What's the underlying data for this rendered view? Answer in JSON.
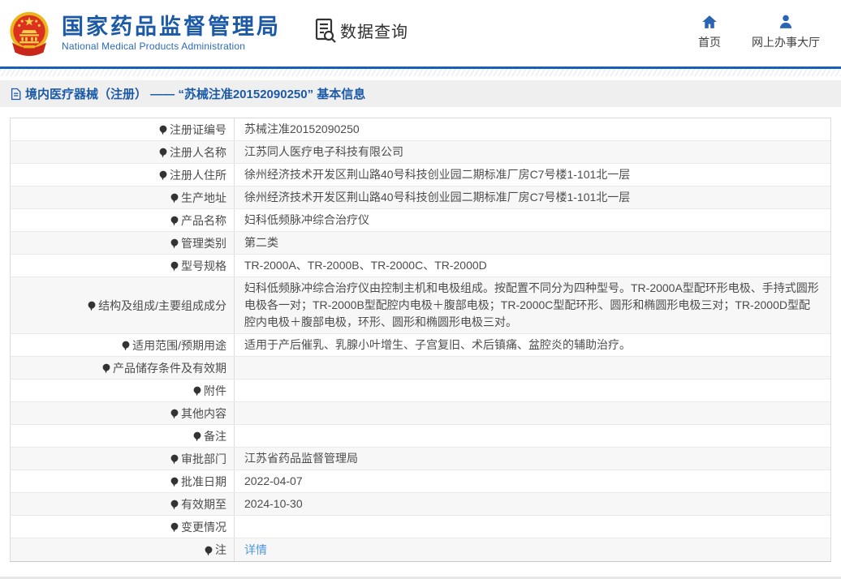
{
  "header": {
    "logo_title": "国家药品监督管理局",
    "logo_subtitle": "National Medical Products Administration",
    "section_label": "数据查询",
    "nav": [
      {
        "label": "首页",
        "icon": "home-icon"
      },
      {
        "label": "网上办事大厅",
        "icon": "user-icon"
      }
    ]
  },
  "breadcrumb": {
    "text": "境内医疗器械（注册） —— “苏械注准20152090250” 基本信息"
  },
  "table": {
    "rows": [
      {
        "label": "注册证编号",
        "value": "苏械注准20152090250"
      },
      {
        "label": "注册人名称",
        "value": "江苏同人医疗电子科技有限公司"
      },
      {
        "label": "注册人住所",
        "value": "徐州经济技术开发区荆山路40号科技创业园二期标准厂房C7号楼1-101北一层"
      },
      {
        "label": "生产地址",
        "value": "徐州经济技术开发区荆山路40号科技创业园二期标准厂房C7号楼1-101北一层"
      },
      {
        "label": "产品名称",
        "value": "妇科低频脉冲综合治疗仪"
      },
      {
        "label": "管理类别",
        "value": "第二类"
      },
      {
        "label": "型号规格",
        "value": "TR-2000A、TR-2000B、TR-2000C、TR-2000D"
      },
      {
        "label": "结构及组成/主要组成成分",
        "value": "妇科低频脉冲综合治疗仪由控制主机和电极组成。按配置不同分为四种型号。TR-2000A型配环形电极、手持式圆形电极各一对；TR-2000B型配腔内电极＋腹部电极；TR-2000C型配环形、圆形和椭圆形电极三对；TR-2000D型配腔内电极＋腹部电极，环形、圆形和椭圆形电极三对。"
      },
      {
        "label": "适用范围/预期用途",
        "value": "适用于产后催乳、乳腺小叶增生、子宫复旧、术后镇痛、盆腔炎的辅助治疗。"
      },
      {
        "label": "产品储存条件及有效期",
        "value": ""
      },
      {
        "label": "附件",
        "value": ""
      },
      {
        "label": "其他内容",
        "value": ""
      },
      {
        "label": "备注",
        "value": ""
      },
      {
        "label": "审批部门",
        "value": "江苏省药品监督管理局"
      },
      {
        "label": "批准日期",
        "value": "2022-04-07"
      },
      {
        "label": "有效期至",
        "value": "2024-10-30"
      },
      {
        "label": "变更情况",
        "value": ""
      },
      {
        "label": "注",
        "value": "详情",
        "link": true,
        "icon": "note-icon"
      }
    ]
  },
  "colors": {
    "accent_blue": "#1c5aa8",
    "header_border_blue": "#1660b8",
    "link_blue": "#4e97e0",
    "alt_row_bg": "#f7f7f7",
    "breadcrumb_bg": "#efefef",
    "emblem_red": "#dc3020",
    "emblem_gold": "#eab61c",
    "nav_icon_blue": "#2c64b4"
  }
}
